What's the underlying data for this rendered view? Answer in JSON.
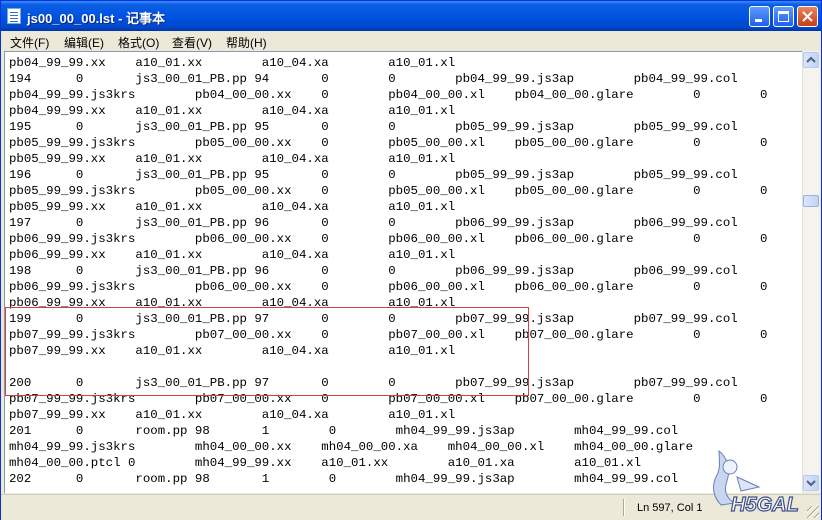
{
  "window": {
    "title": "js00_00_00.lst - 记事本"
  },
  "menu": [
    "文件(F)",
    "编辑(E)",
    "格式(O)",
    "查看(V)",
    "帮助(H)"
  ],
  "lines": [
    "pb04_99_99.xx    a10_01.xx        a10_04.xa        a10_01.xl",
    "194      0       js3_00_01_PB.pp 94       0        0        pb04_99_99.js3ap        pb04_99_99.col",
    "pb04_99_99.js3krs        pb04_00_00.xx    0        pb04_00_00.xl    pb04_00_00.glare        0        0",
    "pb04_99_99.xx    a10_01.xx        a10_04.xa        a10_01.xl",
    "195      0       js3_00_01_PB.pp 95       0        0        pb05_99_99.js3ap        pb05_99_99.col",
    "pb05_99_99.js3krs        pb05_00_00.xx    0        pb05_00_00.xl    pb05_00_00.glare        0        0",
    "pb05_99_99.xx    a10_01.xx        a10_04.xa        a10_01.xl",
    "196      0       js3_00_01_PB.pp 95       0        0        pb05_99_99.js3ap        pb05_99_99.col",
    "pb05_99_99.js3krs        pb05_00_00.xx    0        pb05_00_00.xl    pb05_00_00.glare        0        0",
    "pb05_99_99.xx    a10_01.xx        a10_04.xa        a10_01.xl",
    "197      0       js3_00_01_PB.pp 96       0        0        pb06_99_99.js3ap        pb06_99_99.col",
    "pb06_99_99.js3krs        pb06_00_00.xx    0        pb06_00_00.xl    pb06_00_00.glare        0        0",
    "pb06_99_99.xx    a10_01.xx        a10_04.xa        a10_01.xl",
    "198      0       js3_00_01_PB.pp 96       0        0        pb06_99_99.js3ap        pb06_99_99.col",
    "pb06_99_99.js3krs        pb06_00_00.xx    0        pb06_00_00.xl    pb06_00_00.glare        0        0",
    "pb06_99_99.xx    a10_01.xx        a10_04.xa        a10_01.xl",
    "199      0       js3_00_01_PB.pp 97       0        0        pb07_99_99.js3ap        pb07_99_99.col",
    "pb07_99_99.js3krs        pb07_00_00.xx    0        pb07_00_00.xl    pb07_00_00.glare        0        0",
    "pb07_99_99.xx    a10_01.xx        a10_04.xa        a10_01.xl",
    "",
    "200      0       js3_00_01_PB.pp 97       0        0        pb07_99_99.js3ap        pb07_99_99.col",
    "pb07_99_99.js3krs        pb07_00_00.xx    0        pb07_00_00.xl    pb07_00_00.glare        0        0",
    "pb07_99_99.xx    a10_01.xx        a10_04.xa        a10_01.xl",
    "201      0       room.pp 98       1        0        mh04_99_99.js3ap        mh04_99_99.col",
    "mh04_99_99.js3krs        mh04_00_00.xx    mh04_00_00.xa    mh04_00_00.xl    mh04_00_00.glare",
    "mh04_00_00.ptcl 0        mh04_99_99.xx    a10_01.xx        a10_01.xa        a10_01.xl",
    "202      0       room.pp 98       1        0        mh04_99_99.js3ap        mh04_99_99.col"
  ],
  "status": {
    "position": "Ln 597, Col 1"
  },
  "watermark": {
    "text": "H5GAL"
  },
  "colors": {
    "titlebar": "#0054E3",
    "highlight_box": "#D84040",
    "editor_bg": "#FFFFFF"
  }
}
